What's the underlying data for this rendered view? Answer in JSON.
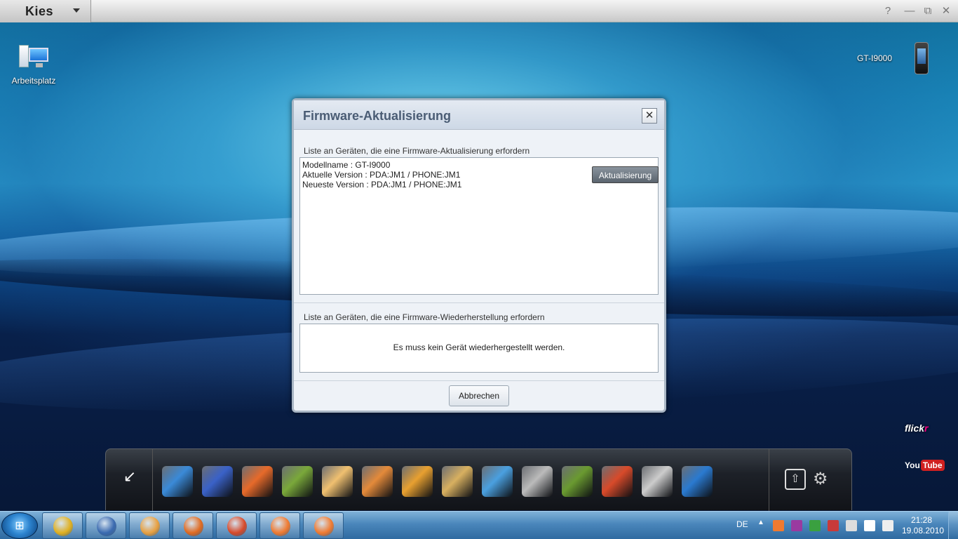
{
  "app": {
    "name": "Kies",
    "window_buttons": {
      "help": "?",
      "minimize": "—",
      "maximize": "⧉",
      "close": "✕"
    }
  },
  "desktop": {
    "computer_label": "Arbeitsplatz",
    "device_label": "GT-I9000"
  },
  "dialog": {
    "title": "Firmware-Aktualisierung",
    "close_symbol": "✕",
    "update_section": {
      "label": "Liste an Geräten, die eine Firmware-Aktualisierung erfordern",
      "model_line": "Modellname : GT-I9000",
      "current_version_line": "Aktuelle Version : PDA:JM1 / PHONE:JM1",
      "latest_version_line": "Neueste Version : PDA:JM1 / PHONE:JM1",
      "update_button": "Aktualisierung"
    },
    "restore_section": {
      "label": "Liste an Geräten, die eine Firmware-Wiederherstellung erfordern",
      "message": "Es muss kein Gerät wiederhergestellt werden."
    },
    "cancel_button": "Abbrechen"
  },
  "side_logos": {
    "flickr_a": "flick",
    "flickr_b": "r",
    "youtube_a": "You",
    "youtube_b": "Tube"
  },
  "dock": {
    "collapse_symbol": "↙",
    "settings_symbol": "⚙",
    "sync_symbol": "⇧",
    "apps": [
      {
        "name": "dock-app-music",
        "color": "#3a8ad8"
      },
      {
        "name": "dock-app-pyramid",
        "color": "#3a62c8"
      },
      {
        "name": "dock-app-phone",
        "color": "#e76a2a"
      },
      {
        "name": "dock-app-calendar",
        "color": "#7aa83a"
      },
      {
        "name": "dock-app-mail",
        "color": "#f0c070"
      },
      {
        "name": "dock-app-notes",
        "color": "#e48a3a"
      },
      {
        "name": "dock-app-photos",
        "color": "#e8a030"
      },
      {
        "name": "dock-app-photo-edit",
        "color": "#d8b060"
      },
      {
        "name": "dock-app-music-player",
        "color": "#4aa0e0"
      },
      {
        "name": "dock-app-video",
        "color": "#bbbbbb"
      },
      {
        "name": "dock-app-sync",
        "color": "#6a9a30"
      },
      {
        "name": "dock-app-burn",
        "color": "#d84a2a"
      },
      {
        "name": "dock-app-disc",
        "color": "#cccccc"
      },
      {
        "name": "dock-app-web",
        "color": "#2a7ad0"
      }
    ]
  },
  "taskbar": {
    "start_symbol": "⊞",
    "language": "DE",
    "tray_chevron": "▲",
    "time": "21:28",
    "date": "19.08.2010",
    "apps": [
      {
        "name": "taskbar-chrome",
        "color": "#e0b020"
      },
      {
        "name": "taskbar-thunderbird",
        "color": "#3a6ab0"
      },
      {
        "name": "taskbar-media",
        "color": "#e8a040"
      },
      {
        "name": "taskbar-firefox",
        "color": "#e06a20"
      },
      {
        "name": "taskbar-tasks",
        "color": "#d84a2a"
      },
      {
        "name": "taskbar-kies-1",
        "color": "#f07a30"
      },
      {
        "name": "taskbar-kies-2",
        "color": "#f07a30"
      }
    ],
    "tray_icons": [
      {
        "name": "tray-kies-icon",
        "color": "#f07a30"
      },
      {
        "name": "tray-onenote-icon",
        "color": "#9a3aa0"
      },
      {
        "name": "tray-check-icon",
        "color": "#3aa040"
      },
      {
        "name": "tray-security-icon",
        "color": "#c83a3a"
      },
      {
        "name": "tray-device-icon",
        "color": "#dddddd"
      },
      {
        "name": "tray-signal-icon",
        "color": "#ffffff"
      },
      {
        "name": "tray-volume-icon",
        "color": "#eeeeee"
      }
    ]
  }
}
